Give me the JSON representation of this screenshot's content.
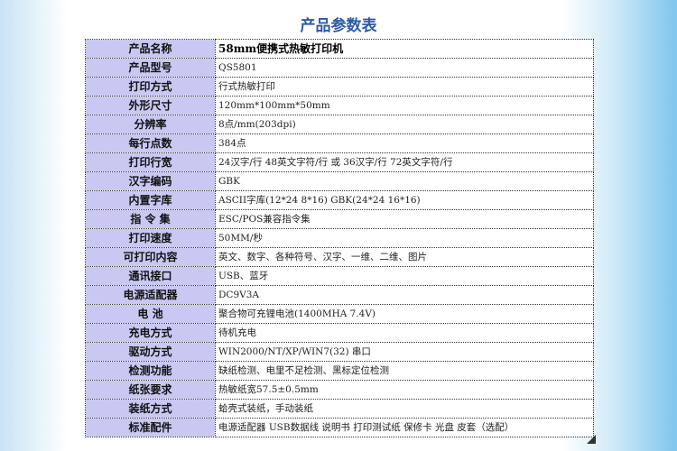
{
  "title": "产品参数表",
  "specs": [
    {
      "label": "产品名称",
      "value": "58mm便携式热敏打印机"
    },
    {
      "label": "产品型号",
      "value": "QS5801"
    },
    {
      "label": "打印方式",
      "value": "行式热敏打印"
    },
    {
      "label": "外形尺寸",
      "value": "120mm*100mm*50mm"
    },
    {
      "label": "分辨率",
      "value": "8点/mm(203dpi)"
    },
    {
      "label": "每行点数",
      "value": "384点"
    },
    {
      "label": "打印行宽",
      "value": "24汉字/行 48英文字符/行 或 36汉字/行 72英文字符/行"
    },
    {
      "label": "汉字编码",
      "value": "GBK"
    },
    {
      "label": "内置字库",
      "value": "ASCII字库(12*24 8*16) GBK(24*24 16*16)"
    },
    {
      "label": "指 令 集",
      "value": "ESC/POS兼容指令集"
    },
    {
      "label": "打印速度",
      "value": "50MM/秒"
    },
    {
      "label": "可打印内容",
      "value": "英文、数字、各种符号、汉字、一维、二维、图片"
    },
    {
      "label": "通讯接口",
      "value": "USB、蓝牙"
    },
    {
      "label": "电源适配器",
      "value": "DC9V3A"
    },
    {
      "label": "电  池",
      "value": "聚合物可充锂电池(1400MHA 7.4V)"
    },
    {
      "label": "充电方式",
      "value": "待机充电"
    },
    {
      "label": "驱动方式",
      "value": "WIN2000/NT/XP/WIN7(32) 串口"
    },
    {
      "label": "检测功能",
      "value": "缺纸检测、电里不足检测、黑标定位检测"
    },
    {
      "label": "纸张要求",
      "value": "热敏纸宽57.5±0.5mm"
    },
    {
      "label": "装纸方式",
      "value": "蛤壳式装纸，手动装纸"
    },
    {
      "label": "标准配件",
      "value": "电源适配器 USB数据线 说明书 打印测试纸 保修卡 光盘 皮套（选配）"
    }
  ]
}
